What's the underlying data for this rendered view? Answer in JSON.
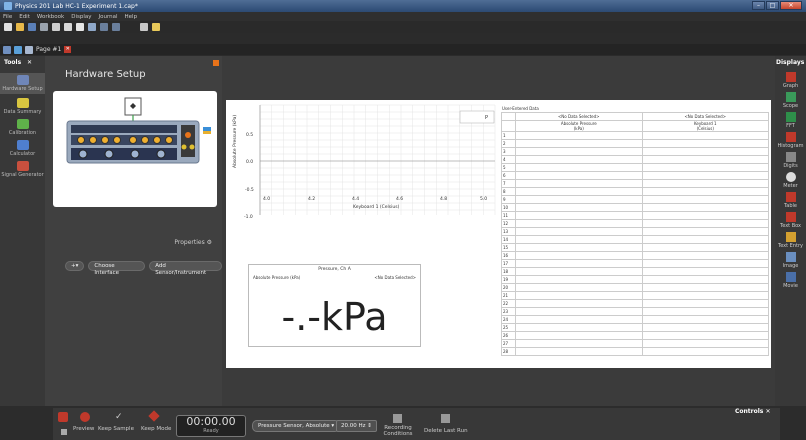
{
  "window": {
    "title": "Physics 201 Lab HC-1 Experiment 1.cap*"
  },
  "menu": [
    "File",
    "Edit",
    "Workbook",
    "Display",
    "Journal",
    "Help"
  ],
  "page_tab": {
    "label": "Page #1"
  },
  "tools": {
    "title": "Tools",
    "items": [
      "Hardware Setup",
      "Data Summary",
      "Calibration",
      "Calculator",
      "Signal Generator"
    ]
  },
  "hardware": {
    "title": "Hardware Setup",
    "properties_label": "Properties",
    "choose_interface": "Choose Interface",
    "add_sensor": "Add Sensor/Instrument"
  },
  "displays": {
    "title": "Displays",
    "items": [
      "Graph",
      "Scope",
      "FFT",
      "Histogram",
      "Digits",
      "Meter",
      "Table",
      "Text Box",
      "Text Entry",
      "Image",
      "Movie"
    ]
  },
  "graph": {
    "ylabel": "Absolute Pressure (kPa)",
    "xlabel": "Keyboard 1 (Celsius)",
    "yticks": [
      "0.5",
      "0.0",
      "-0.5",
      "-1.0"
    ],
    "xticks": [
      "4.0",
      "4.2",
      "4.4",
      "4.6",
      "4.8",
      "5.0"
    ]
  },
  "meter": {
    "title": "Pressure, Ch A",
    "left_label": "Absolute Pressure (kPa)",
    "right_label": "<No Data Selected>",
    "value": "-.-kPa"
  },
  "table": {
    "title": "User-Entered Data",
    "col1_header": "<No Data Selected>",
    "col2_header": "<No Data Selected>",
    "col1_name": "Absolute Pressure",
    "col1_unit": "(kPa)",
    "col2_name": "Keyboard 1",
    "col2_unit": "(Celsius)",
    "rows": 28
  },
  "bottom": {
    "preview": "Preview",
    "keep_sample": "Keep Sample",
    "keep_mode": "Keep Mode",
    "timer": "00:00.00",
    "timer_status": "Ready",
    "sensor": "Pressure Sensor, Absolute",
    "rate": "20.00 Hz",
    "recording": "Recording Conditions",
    "delete_last_run": "Delete Last Run",
    "controls": "Controls"
  }
}
